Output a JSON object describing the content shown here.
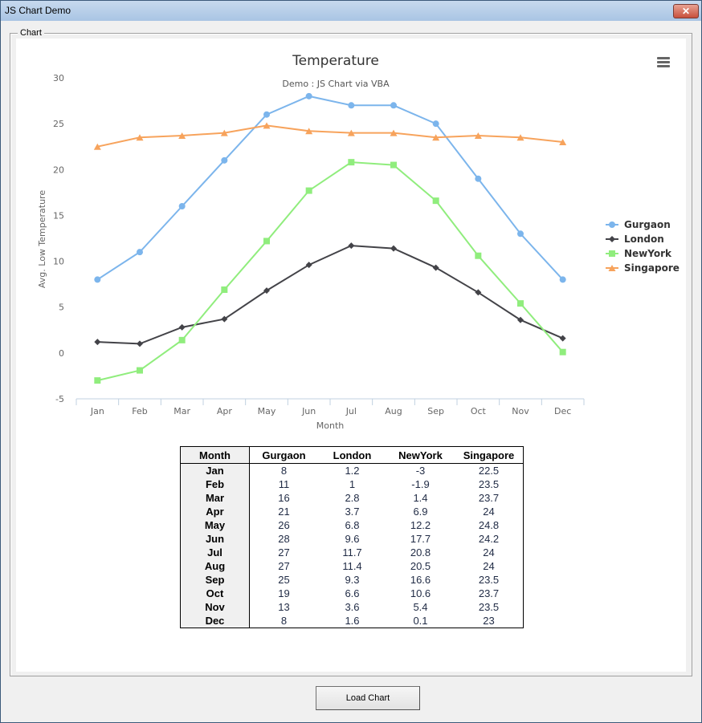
{
  "window": {
    "title": "JS Chart Demo",
    "close_label": "✕"
  },
  "frame": {
    "label": "Chart"
  },
  "button": {
    "load_label": "Load Chart"
  },
  "menu_icon": "hamburger-menu-icon",
  "chart_data": {
    "type": "line",
    "title": "Temperature",
    "subtitle": "Demo : JS Chart via VBA",
    "xlabel": "Month",
    "ylabel": "Avg. Low Temperature",
    "ylim": [
      -5,
      30
    ],
    "yticks": [
      -5,
      0,
      5,
      10,
      15,
      20,
      25,
      30
    ],
    "grid": false,
    "legend_position": "right",
    "categories": [
      "Jan",
      "Feb",
      "Mar",
      "Apr",
      "May",
      "Jun",
      "Jul",
      "Aug",
      "Sep",
      "Oct",
      "Nov",
      "Dec"
    ],
    "series": [
      {
        "name": "Gurgaon",
        "color": "#7cb5ec",
        "marker": "circle",
        "values": [
          8,
          11,
          16,
          21,
          26,
          28,
          27,
          27,
          25,
          19,
          13,
          8
        ]
      },
      {
        "name": "London",
        "color": "#434348",
        "marker": "diamond",
        "values": [
          1.2,
          1,
          2.8,
          3.7,
          6.8,
          9.6,
          11.7,
          11.4,
          9.3,
          6.6,
          3.6,
          1.6
        ]
      },
      {
        "name": "NewYork",
        "color": "#90ed7d",
        "marker": "square",
        "values": [
          -3,
          -1.9,
          1.4,
          6.9,
          12.2,
          17.7,
          20.8,
          20.5,
          16.6,
          10.6,
          5.4,
          0.1
        ]
      },
      {
        "name": "Singapore",
        "color": "#f7a35c",
        "marker": "triangle",
        "values": [
          22.5,
          23.5,
          23.7,
          24,
          24.8,
          24.2,
          24,
          24,
          23.5,
          23.7,
          23.5,
          23
        ]
      }
    ]
  },
  "table": {
    "headers": [
      "Month",
      "Gurgaon",
      "London",
      "NewYork",
      "Singapore"
    ],
    "rows": [
      [
        "Jan",
        "8",
        "1.2",
        "-3",
        "22.5"
      ],
      [
        "Feb",
        "11",
        "1",
        "-1.9",
        "23.5"
      ],
      [
        "Mar",
        "16",
        "2.8",
        "1.4",
        "23.7"
      ],
      [
        "Apr",
        "21",
        "3.7",
        "6.9",
        "24"
      ],
      [
        "May",
        "26",
        "6.8",
        "12.2",
        "24.8"
      ],
      [
        "Jun",
        "28",
        "9.6",
        "17.7",
        "24.2"
      ],
      [
        "Jul",
        "27",
        "11.7",
        "20.8",
        "24"
      ],
      [
        "Aug",
        "27",
        "11.4",
        "20.5",
        "24"
      ],
      [
        "Sep",
        "25",
        "9.3",
        "16.6",
        "23.5"
      ],
      [
        "Oct",
        "19",
        "6.6",
        "10.6",
        "23.7"
      ],
      [
        "Nov",
        "13",
        "3.6",
        "5.4",
        "23.5"
      ],
      [
        "Dec",
        "8",
        "1.6",
        "0.1",
        "23"
      ]
    ]
  }
}
